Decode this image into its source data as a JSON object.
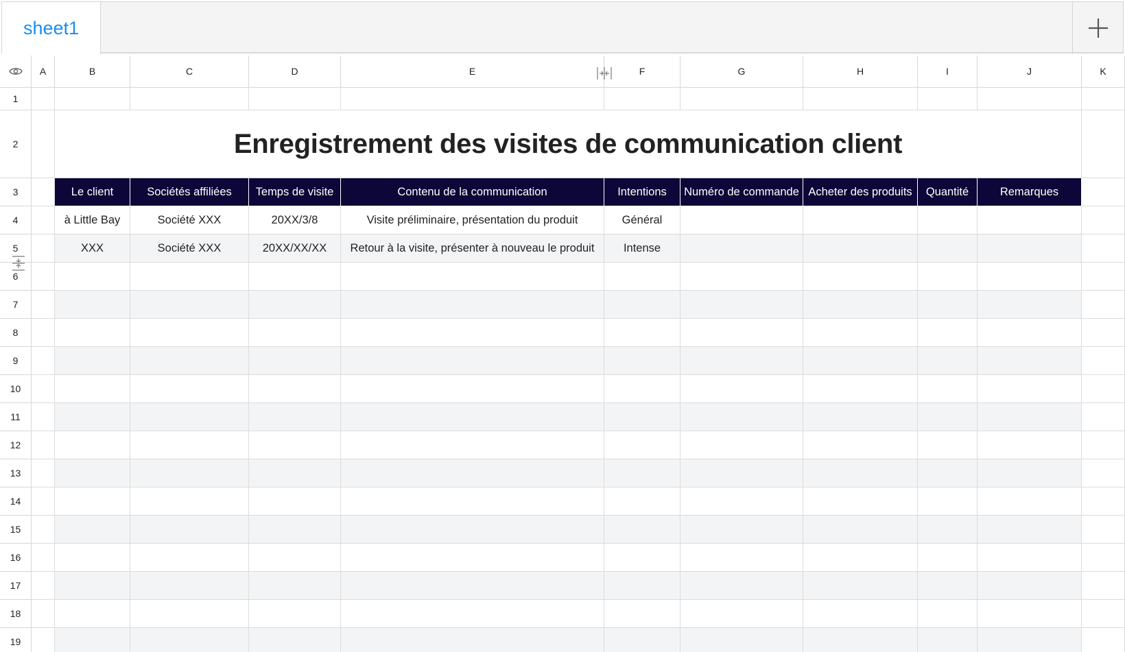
{
  "tabs": [
    {
      "label": "sheet1"
    }
  ],
  "columns": [
    "A",
    "B",
    "C",
    "D",
    "E",
    "F",
    "G",
    "H",
    "I",
    "J",
    "K"
  ],
  "rows": [
    "1",
    "2",
    "3",
    "4",
    "5",
    "6",
    "7",
    "8",
    "9",
    "10",
    "11",
    "12",
    "13",
    "14",
    "15",
    "16",
    "17",
    "18",
    "19"
  ],
  "title": "Enregistrement des visites de communication client",
  "headers": [
    "Le client",
    "Sociétés affiliées",
    "Temps de visite",
    "Contenu de la communication",
    "Intentions",
    "Numéro de commande",
    "Acheter des produits",
    "Quantité",
    "Remarques"
  ],
  "records": [
    [
      "à Little Bay",
      "Société XXX",
      "20XX/3/8",
      "Visite préliminaire, présentation du produit",
      "Général",
      "",
      "",
      "",
      ""
    ],
    [
      "XXX",
      "Société XXX",
      "20XX/XX/XX",
      "Retour à la visite, présenter à nouveau le produit",
      "Intense",
      "",
      "",
      "",
      ""
    ]
  ],
  "colors": {
    "header_bg": "#0d0638",
    "header_text": "#ffffff",
    "tab_text": "#1a8ff0",
    "alt_row": "#f3f4f6"
  },
  "icons": {
    "add_tab": "plus-icon",
    "corner": "eye-icon",
    "resize": "column-resize-icon"
  }
}
